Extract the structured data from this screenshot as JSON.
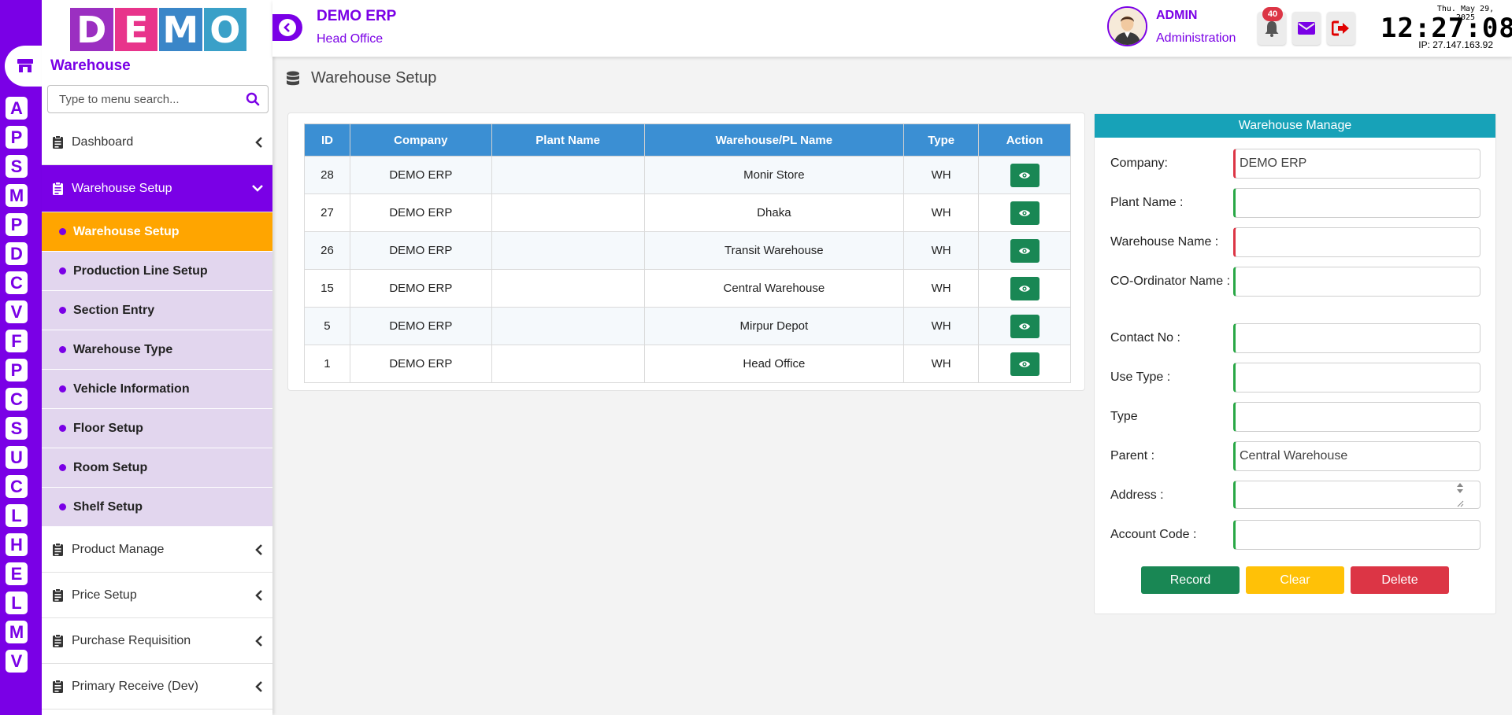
{
  "rail": {
    "letters": [
      "A",
      "P",
      "S",
      "M",
      "P",
      "D",
      "C",
      "V",
      "F",
      "P",
      "C",
      "S",
      "U",
      "C",
      "L",
      "H",
      "E",
      "L",
      "M",
      "V"
    ]
  },
  "sidebar": {
    "logo_letters": [
      "D",
      "E",
      "M",
      "O"
    ],
    "logo_colors": [
      "#9b2fc1",
      "#e8348b",
      "#3a86c8",
      "#3aa0c8"
    ],
    "module_title": "Warehouse",
    "search_placeholder": "Type to menu search...",
    "menu_top": {
      "label": "Dashboard"
    },
    "menu_active": {
      "label": "Warehouse Setup"
    },
    "sub_items": [
      {
        "label": "Warehouse Setup",
        "current": true
      },
      {
        "label": "Production Line Setup"
      },
      {
        "label": "Section Entry"
      },
      {
        "label": "Warehouse Type"
      },
      {
        "label": "Vehicle Information"
      },
      {
        "label": "Floor Setup"
      },
      {
        "label": "Room Setup"
      },
      {
        "label": "Shelf Setup"
      }
    ],
    "menu_bottom": [
      {
        "label": "Product Manage"
      },
      {
        "label": "Price Setup"
      },
      {
        "label": "Purchase Requisition"
      },
      {
        "label": "Primary Receive (Dev)"
      }
    ]
  },
  "header": {
    "company": "DEMO ERP",
    "branch": "Head Office",
    "user": "ADMIN",
    "role": "Administration",
    "notification_count": "40",
    "clock_date": "Thu. May 29, 2025",
    "clock_time": "12:27:08",
    "ip": "IP: 27.147.163.92"
  },
  "page": {
    "title": "Warehouse Setup"
  },
  "table": {
    "columns": [
      "ID",
      "Company",
      "Plant Name",
      "Warehouse/PL Name",
      "Type",
      "Action"
    ],
    "rows": [
      {
        "id": "28",
        "company": "DEMO ERP",
        "plant": "",
        "name": "Monir Store",
        "type": "WH"
      },
      {
        "id": "27",
        "company": "DEMO ERP",
        "plant": "",
        "name": "Dhaka",
        "type": "WH"
      },
      {
        "id": "26",
        "company": "DEMO ERP",
        "plant": "",
        "name": "Transit Warehouse",
        "type": "WH"
      },
      {
        "id": "15",
        "company": "DEMO ERP",
        "plant": "",
        "name": "Central Warehouse",
        "type": "WH"
      },
      {
        "id": "5",
        "company": "DEMO ERP",
        "plant": "",
        "name": "Mirpur Depot",
        "type": "WH"
      },
      {
        "id": "1",
        "company": "DEMO ERP",
        "plant": "",
        "name": "Head Office",
        "type": "WH"
      }
    ]
  },
  "form": {
    "title": "Warehouse Manage",
    "fields": {
      "company": {
        "label": "Company:",
        "value": "DEMO ERP"
      },
      "plant": {
        "label": "Plant Name :",
        "value": ""
      },
      "warehouse": {
        "label": "Warehouse Name :",
        "value": ""
      },
      "coordinator": {
        "label": "CO-Ordinator Name :",
        "value": ""
      },
      "contact": {
        "label": "Contact No :",
        "value": ""
      },
      "use_type": {
        "label": "Use Type :",
        "value": ""
      },
      "type": {
        "label": "Type",
        "value": ""
      },
      "parent": {
        "label": "Parent :",
        "value": "Central Warehouse"
      },
      "address": {
        "label": "Address :",
        "value": ""
      },
      "account": {
        "label": "Account Code :",
        "value": ""
      }
    },
    "buttons": {
      "record": "Record",
      "clear": "Clear",
      "delete": "Delete"
    }
  }
}
